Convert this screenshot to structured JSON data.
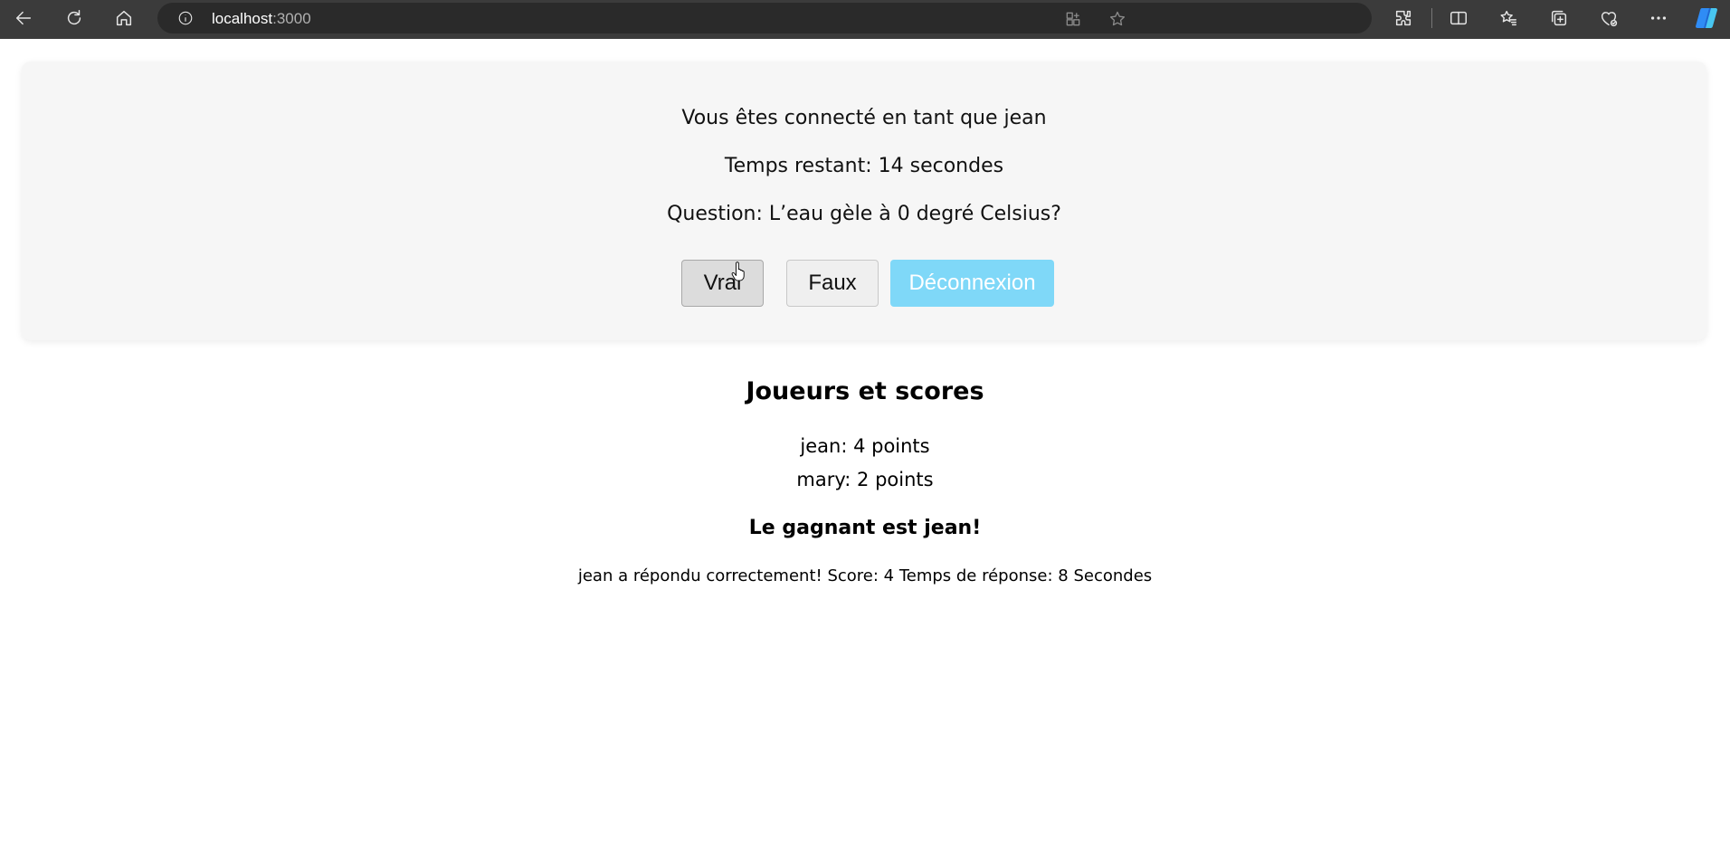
{
  "browser": {
    "url_host": "localhost",
    "url_port": ":3000",
    "icons": [
      "back-icon",
      "refresh-icon",
      "home-icon",
      "info-icon",
      "app-available-icon",
      "favorite-star-icon",
      "extensions-icon",
      "split-screen-icon",
      "favorites-icon",
      "collections-icon",
      "browser-essentials-icon",
      "more-icon",
      "copilot-icon"
    ]
  },
  "game": {
    "connected_text": "Vous êtes connecté en tant que jean",
    "time_text": "Temps restant: 14 secondes",
    "question_text": "Question: L’eau gèle à 0 degré Celsius?",
    "true_label": "Vrai",
    "false_label": "Faux",
    "logout_label": "Déconnexion"
  },
  "scores": {
    "title": "Joueurs et scores",
    "players": [
      "jean: 4 points",
      "mary: 2 points"
    ],
    "winner_text": "Le gagnant est jean!",
    "result_message": "jean a répondu correctement! Score: 4 Temps de réponse: 8 Secondes"
  },
  "colors": {
    "logout_button": "#7fd8f8",
    "card_background": "#f6f6f6",
    "chrome_background": "#3b3b3b"
  }
}
